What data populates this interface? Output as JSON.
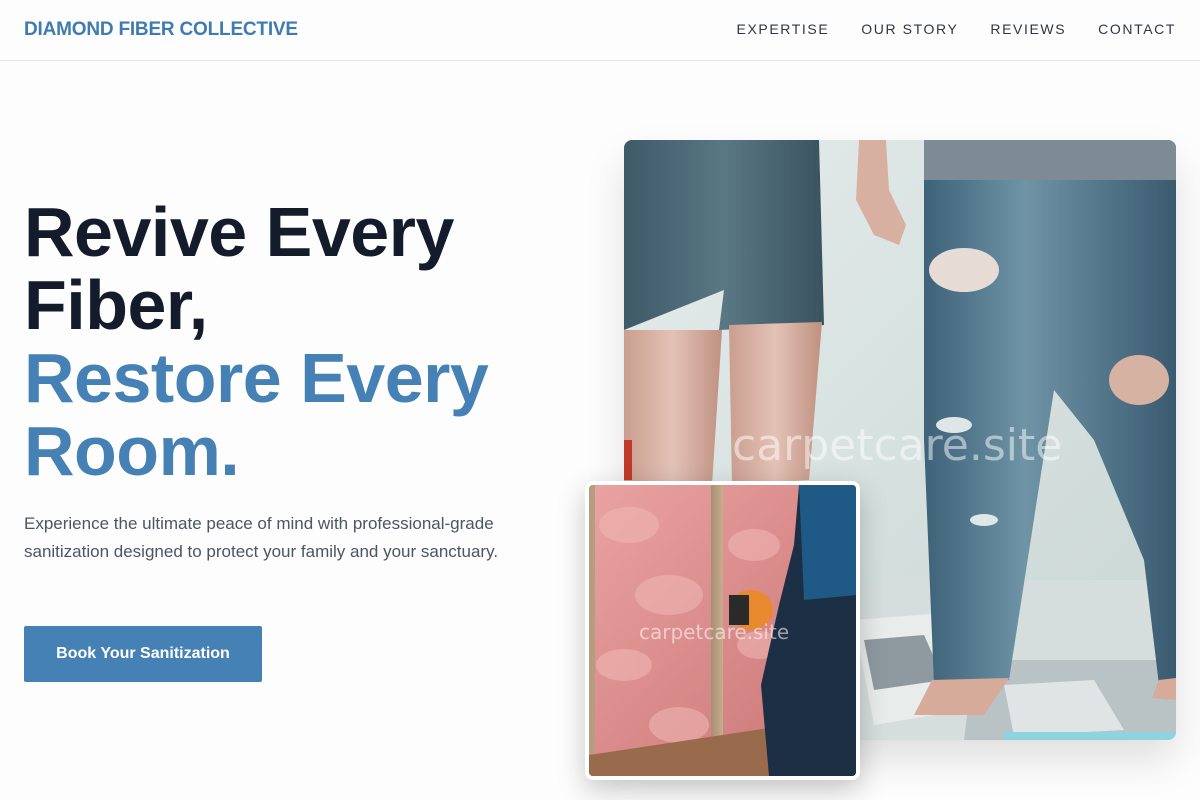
{
  "nav": {
    "brand": "DIAMOND FIBER COLLECTIVE",
    "links": [
      "EXPERTISE",
      "OUR STORY",
      "REVIEWS",
      "CONTACT"
    ]
  },
  "hero": {
    "headline_dark_1": "Revive Every",
    "headline_dark_2": "Fiber,",
    "headline_accent_1": "Restore Every",
    "headline_accent_2": "Room.",
    "lead": "Experience the ultimate peace of mind with professional-grade sanitization designed to protect your family and your sanctuary.",
    "cta_label": "Book Your Sanitization"
  },
  "images": {
    "main_watermark": "carpetcare.site",
    "small_watermark": "carpetcare.site"
  },
  "colors": {
    "brand": "#3f7bb1",
    "accent": "#4681b6",
    "heading": "#141b2b",
    "body_text": "#4c5563"
  }
}
